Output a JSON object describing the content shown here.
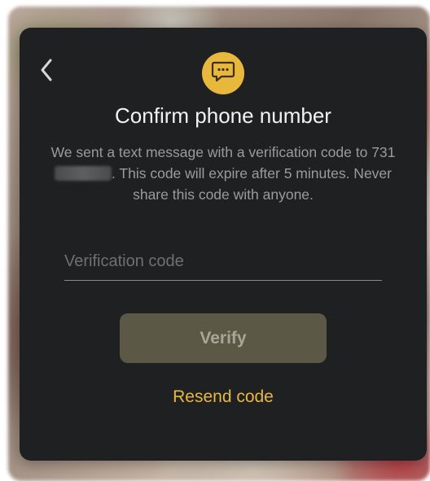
{
  "dialog": {
    "title": "Confirm phone number",
    "description_before": "We sent a text message with a verification code to 731",
    "description_after": ". This code will expire after 5 minutes. Never share this code with anyone.",
    "input_placeholder": "Verification code",
    "input_value": "",
    "verify_label": "Verify",
    "resend_label": "Resend code"
  },
  "icons": {
    "back": "chevron-left-icon",
    "badge": "chat-bubble-icon"
  },
  "colors": {
    "accent": "#e8b83a",
    "modal_bg": "#1f2022",
    "verify_bg": "#5b5846"
  }
}
